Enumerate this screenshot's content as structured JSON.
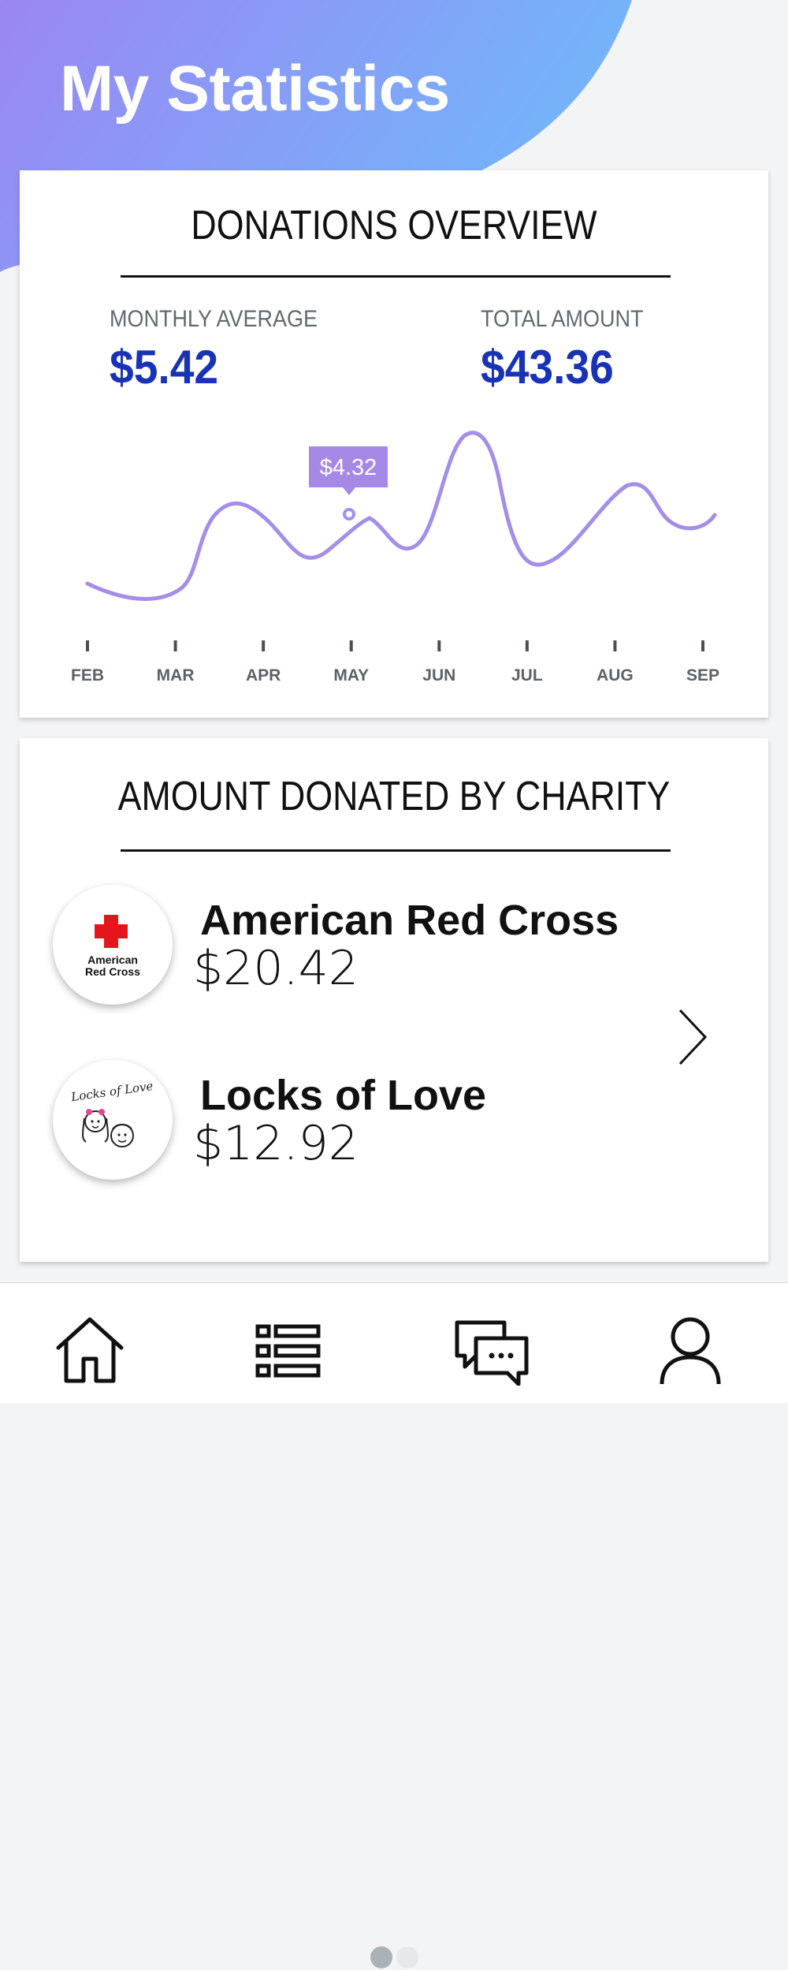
{
  "page": {
    "title": "My Statistics"
  },
  "overview": {
    "title": "DONATIONS OVERVIEW",
    "monthly_average_label": "MONTHLY AVERAGE",
    "monthly_average_value": "$5.42",
    "total_amount_label": "TOTAL AMOUNT",
    "total_amount_value": "$43.36"
  },
  "chart_data": {
    "type": "line",
    "categories": [
      "FEB",
      "MAR",
      "APR",
      "MAY",
      "JUN",
      "JUL",
      "AUG",
      "SEP"
    ],
    "highlight": {
      "category": "MAY",
      "label": "$4.32"
    },
    "grid": false,
    "legend": "none"
  },
  "charity": {
    "title": "AMOUNT DONATED BY CHARITY",
    "items": [
      {
        "name": "American Red Cross",
        "amount": "$20.42",
        "logo_text_1": "American",
        "logo_text_2": "Red Cross",
        "logo_icon": "red-cross-logo"
      },
      {
        "name": "Locks of Love",
        "amount": "$12.92",
        "logo_text": "Locks of Love",
        "logo_icon": "locks-of-love-logo"
      }
    ],
    "pagination": {
      "pages": 2,
      "current": 1
    }
  },
  "nav": {
    "items": [
      {
        "icon": "home-icon"
      },
      {
        "icon": "list-icon"
      },
      {
        "icon": "chat-icon"
      },
      {
        "icon": "profile-icon"
      }
    ]
  },
  "colors": {
    "header_gradient_start": "#9b86f2",
    "header_gradient_end": "#72b6fb",
    "value_blue": "#1833b5",
    "line_purple": "#a58ee8",
    "tooltip_purple": "#a688e6",
    "dot_active": "#a9b2b6",
    "dot_inactive": "#e6e9ea"
  }
}
